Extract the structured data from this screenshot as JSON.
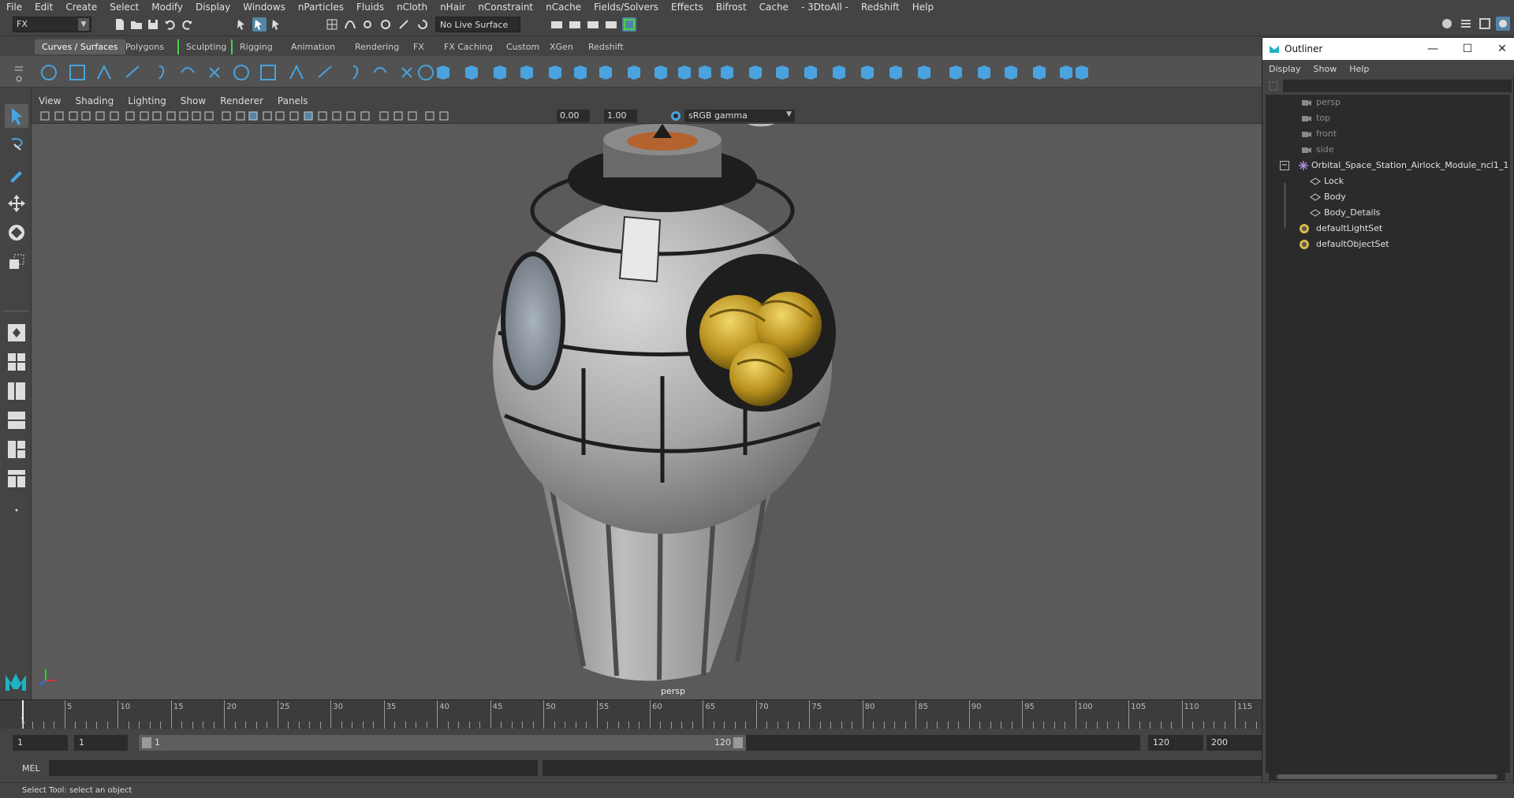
{
  "menubar": [
    "File",
    "Edit",
    "Create",
    "Select",
    "Modify",
    "Display",
    "Windows",
    "nParticles",
    "Fluids",
    "nCloth",
    "nHair",
    "nConstraint",
    "nCache",
    "Fields/Solvers",
    "Effects",
    "Bifrost",
    "Cache",
    "- 3DtoAll -",
    "Redshift",
    "Help"
  ],
  "status": {
    "mode": "FX",
    "live_surface": "No Live Surface"
  },
  "shelf_tabs": [
    "Curves / Surfaces",
    "Polygons",
    "Sculpting",
    "Rigging",
    "Animation",
    "Rendering",
    "FX",
    "FX Caching",
    "Custom",
    "XGen",
    "Redshift"
  ],
  "panel_menu": [
    "View",
    "Shading",
    "Lighting",
    "Show",
    "Renderer",
    "Panels"
  ],
  "panel_toolbar": {
    "exposure": "0.00",
    "gamma": "1.00",
    "colorspace": "sRGB gamma"
  },
  "viewport": {
    "camera_label": "persp"
  },
  "outliner": {
    "title": "Outliner",
    "menu": [
      "Display",
      "Show",
      "Help"
    ],
    "items": [
      {
        "label": "persp",
        "type": "camera"
      },
      {
        "label": "top",
        "type": "camera"
      },
      {
        "label": "front",
        "type": "camera"
      },
      {
        "label": "side",
        "type": "camera"
      },
      {
        "label": "Orbital_Space_Station_Airlock_Module_ncl1_1",
        "type": "group"
      },
      {
        "label": "Lock",
        "type": "mesh"
      },
      {
        "label": "Body",
        "type": "mesh"
      },
      {
        "label": "Body_Details",
        "type": "mesh"
      },
      {
        "label": "defaultLightSet",
        "type": "set"
      },
      {
        "label": "defaultObjectSet",
        "type": "set"
      }
    ]
  },
  "timeline": {
    "ticks": [
      "5",
      "10",
      "15",
      "20",
      "25",
      "30",
      "35",
      "40",
      "45",
      "50",
      "55",
      "60",
      "65",
      "70",
      "75",
      "80",
      "85",
      "90",
      "95",
      "100",
      "105",
      "110",
      "115"
    ],
    "current_frame": "1"
  },
  "range": {
    "start": "1",
    "playback_start": "1",
    "slider_start": "1",
    "slider_end": "120",
    "playback_end": "120",
    "end": "200"
  },
  "cmdline": {
    "lang": "MEL"
  },
  "helpline": "Select Tool: select an object",
  "colors": {
    "accent": "#5285a6",
    "shelf_icon": "#4aa3df",
    "gold": "#c9a227"
  }
}
